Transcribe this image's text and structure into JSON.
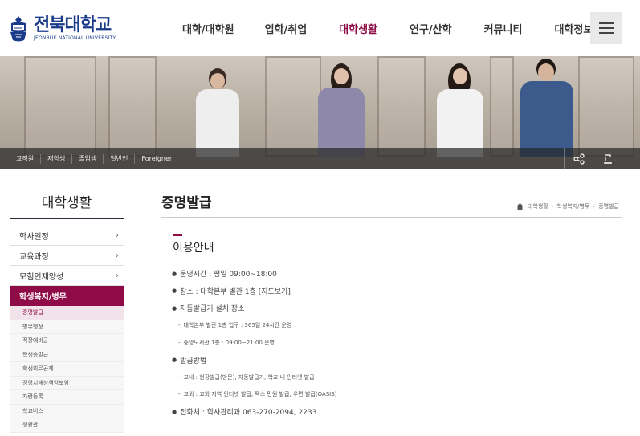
{
  "logo": {
    "korean": "전북대학교",
    "english": "JEONBUK NATIONAL UNIVERSITY"
  },
  "gnb": [
    {
      "label": "대학/대학원"
    },
    {
      "label": "입학/취업"
    },
    {
      "label": "대학생활",
      "active": true
    },
    {
      "label": "연구/산학"
    },
    {
      "label": "커뮤니티"
    },
    {
      "label": "대학정보"
    }
  ],
  "quick_links": [
    "교직원",
    "재학생",
    "졸업생",
    "일반인",
    "Foreigner"
  ],
  "hero_buttons": [
    "share-icon",
    "print-icon"
  ],
  "sidebar": {
    "title": "대학생활",
    "items": [
      {
        "label": "학사일정",
        "arrow": "›"
      },
      {
        "label": "교육과정",
        "arrow": "›"
      },
      {
        "label": "모험인재양성",
        "arrow": "›"
      }
    ],
    "active": "학생복지/병무",
    "sub_items": [
      "증명발급",
      "병무행정",
      "직장예비군",
      "학생증발급",
      "학생의료공제",
      "경영지배상책임보험",
      "자랑등록",
      "학교버스",
      "생활관"
    ]
  },
  "content": {
    "title": "증명발급",
    "breadcrumb": [
      "대학생활",
      "학생복지/병무",
      "증명발급"
    ],
    "section_title": "이용안내",
    "rows": [
      {
        "type": "main",
        "text": "운영시간 : 평일 09:00~18:00"
      },
      {
        "type": "main",
        "text": "장소 : 대학본부  별관 1층 [지도보기]"
      },
      {
        "type": "main",
        "text": "자동발급기 설치 장소"
      },
      {
        "type": "sub",
        "text": "대학본부 별관 1층 입구 : 365일 24시간 운영"
      },
      {
        "type": "sub",
        "text": "중앙도서관 1층 : 09:00~21:00 운영"
      },
      {
        "type": "main",
        "text": "발급방법"
      },
      {
        "type": "sub",
        "text": "교내 : 현장발급(방문), 자동발급기, 학교 내 인터넷 발급"
      },
      {
        "type": "sub",
        "text": "교외 : 교외 지역 인터넷 발급, 팩스 민원 발급, 우편 발급(OASIS)"
      },
      {
        "type": "main",
        "text": "전화처 : 학사관리과 063-270-2094, 2233"
      }
    ]
  },
  "colors": {
    "accent": "#8e0b47",
    "brand": "#1a3a8a"
  }
}
